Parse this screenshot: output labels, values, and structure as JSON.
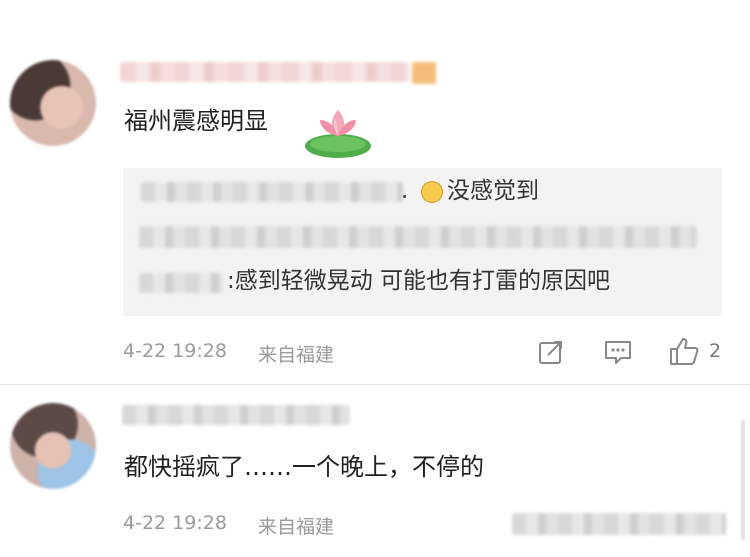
{
  "comments": [
    {
      "text": "福州震感明显",
      "quote": {
        "reply_text": "没感觉到",
        "reply_separator": ".",
        "second_reply_text": ":感到轻微晃动 可能也有打雷的原因吧"
      },
      "time": "4-22 19:28",
      "location": "来自福建",
      "like_count": "2"
    },
    {
      "text": "都快摇疯了……一个晚上，不停的",
      "time": "4-22 19:28",
      "location": "来自福建"
    }
  ],
  "icons": {
    "avatar": "avatar",
    "emoji_lotus": "lotus-emoji-icon",
    "emoji_laugh": "laugh-cry-emoji-icon",
    "share": "share-icon",
    "comment": "comment-icon",
    "like": "thumbs-up-icon"
  },
  "colors": {
    "meta_text": "#9a9a9a",
    "quote_background": "#f3f3f3",
    "name_blur": "#f2d5d5"
  }
}
